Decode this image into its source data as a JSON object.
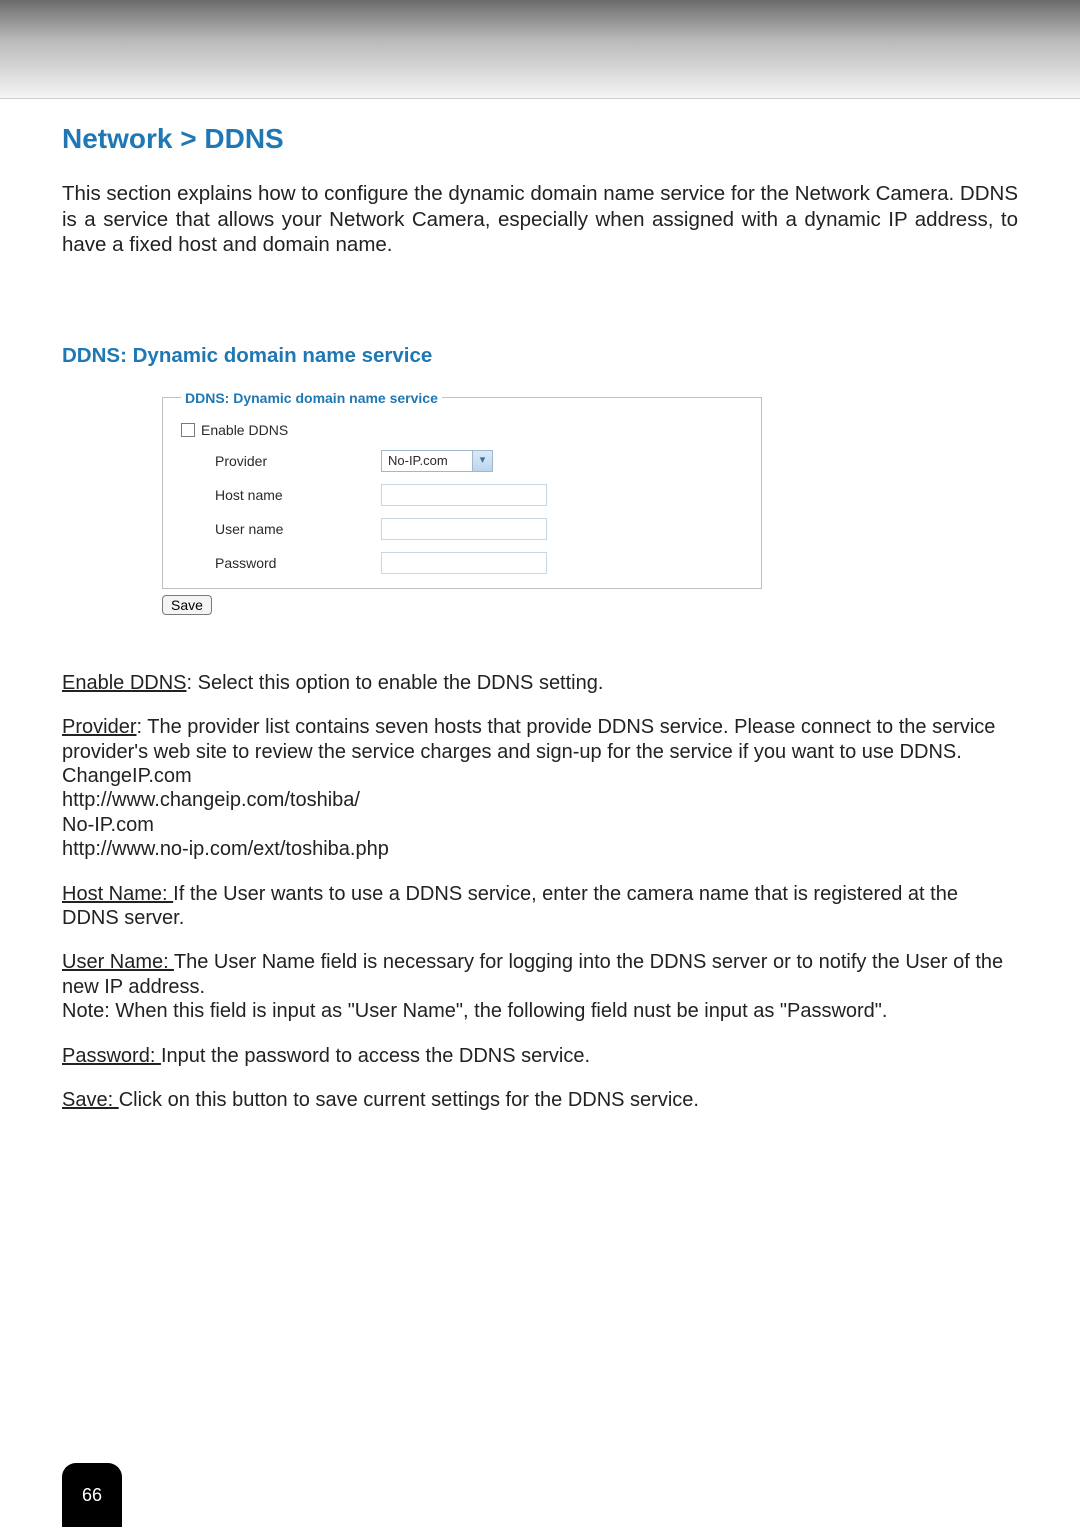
{
  "breadcrumb": "Network > DDNS",
  "intro": "This section explains how to configure the dynamic domain name service for the Network Camera. DDNS is a service that allows your Network Camera, especially when assigned with a dynamic IP address, to have a fixed host and domain name.",
  "subheading": "DDNS: Dynamic domain name service",
  "panel": {
    "legend": "DDNS: Dynamic domain name service",
    "enable_label": "Enable DDNS",
    "provider_label": "Provider",
    "provider_value": "No-IP.com",
    "hostname_label": "Host name",
    "hostname_value": "",
    "username_label": "User name",
    "username_value": "",
    "password_label": "Password",
    "password_value": "",
    "save_label": "Save"
  },
  "doc": {
    "enable_ddns_term": "Enable DDNS",
    "enable_ddns_text": ": Select this option to enable the DDNS setting.",
    "provider_term": "Provider",
    "provider_text": ": The provider list contains seven hosts that provide DDNS service. Please connect to the service provider's web site to review the service charges and sign-up for the service if you want to use DDNS.",
    "changeip_line1": "ChangeIP.com",
    "changeip_line2": "http://www.changeip.com/toshiba/",
    "noip_line1": "No-IP.com",
    "noip_line2": "http://www.no-ip.com/ext/toshiba.php",
    "hostname_term": "Host Name: ",
    "hostname_text": "If the User wants to use a DDNS service, enter the camera name that is registered at the DDNS server.",
    "username_term": "User Name: ",
    "username_text": "The User Name field is necessary for logging into the DDNS server or to notify the User of the new IP address.",
    "username_note": "Note: When this field is input as \"User Name\", the following field nust be input as \"Password\".",
    "password_term": "Password: ",
    "password_text": "Input the password to access the DDNS service.",
    "save_term": "Save: ",
    "save_text": "Click on this button to save current settings for the DDNS service."
  },
  "page_number": "66"
}
